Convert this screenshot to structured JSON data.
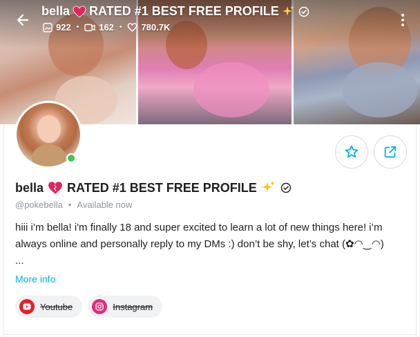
{
  "header": {
    "title": "bella",
    "title_suffix": "RATED #1 BEST FREE PROFILE",
    "stats": {
      "photos": "922",
      "videos": "162",
      "likes": "780.7K"
    }
  },
  "profile": {
    "name": "bella",
    "name_suffix": "RATED #1 BEST FREE PROFILE",
    "handle": "@pokebella",
    "status": "Available now",
    "online": true,
    "bio_line1": "hiii i’m bella! i'm finally 18 and super excited to learn a lot of new things here! i’m",
    "bio_line2": "always online and personally reply to my DMs :) don’t be shy, let’s chat (✿◠‿◠)",
    "bio_line3": "...",
    "more_info_label": "More info"
  },
  "social_links": [
    {
      "label": "Youtube",
      "icon": "youtube-icon",
      "color": "#e5202a"
    },
    {
      "label": "Instagram",
      "icon": "instagram-icon",
      "color": "#e12d7a"
    }
  ],
  "colors": {
    "accent": "#00aff0",
    "online": "#3cc755",
    "muted": "#8a96a3"
  }
}
